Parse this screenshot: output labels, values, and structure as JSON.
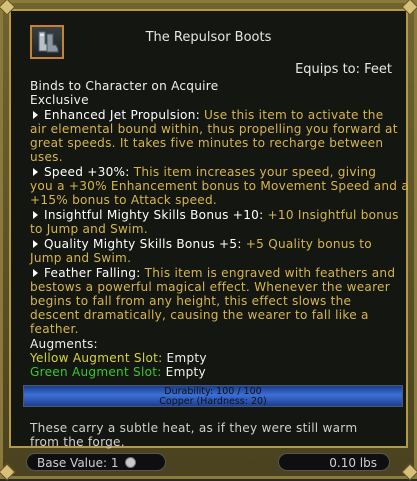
{
  "item": {
    "title": "The Repulsor Boots",
    "equips_to": "Equips to: Feet",
    "binds": "Binds to Character on Acquire",
    "exclusive": "Exclusive",
    "icon": "boots-icon"
  },
  "enhancements": [
    {
      "name": "Enhanced Jet Propulsion:",
      "desc_lines": [
        "Use this item to activate the",
        "air elemental bound within, thus propelling you forward at",
        "great speeds. It takes five minutes to recharge between",
        "uses."
      ]
    },
    {
      "name": "Speed +30%:",
      "desc_lines": [
        "This item increases your speed, giving",
        "you a +30% Enhancement bonus to Movement Speed and a",
        "+15% bonus to Attack speed."
      ]
    },
    {
      "name": "Insightful Mighty Skills Bonus +10:",
      "desc_lines": [
        "+10 Insightful bonus",
        "to Jump and Swim."
      ]
    },
    {
      "name": "Quality Mighty Skills Bonus +5:",
      "desc_lines": [
        "+5 Quality bonus to",
        "Jump and Swim."
      ]
    },
    {
      "name": "Feather Falling:",
      "desc_lines": [
        "This item is engraved with feathers and",
        "bestows a powerful magical effect. Whenever the wearer",
        "begins to fall from any height, this effect slows the",
        "descent dramatically, causing the wearer to fall like a",
        "feather."
      ]
    }
  ],
  "augments": {
    "header": "Augments:",
    "yellow_label": "Yellow Augment Slot:",
    "yellow_value": "Empty",
    "green_label": "Green Augment Slot:",
    "green_value": "Empty"
  },
  "durability": {
    "line1": "Durability: 100 / 100",
    "line2": "Copper (Hardness: 20)",
    "current": 100,
    "max": 100
  },
  "flavor": [
    "These carry a subtle heat, as if they were still warm",
    "from the forge."
  ],
  "footer": {
    "base_value": "Base Value: 1",
    "coin_icon": "coin-icon",
    "weight": "0.10 lbs"
  },
  "colors": {
    "frame": "#8c7a3a",
    "enhancement_desc": "#d6b64b",
    "yellow_slot": "#d8d23a",
    "green_slot": "#38c828",
    "durability_bar": "#3c6fd6"
  }
}
